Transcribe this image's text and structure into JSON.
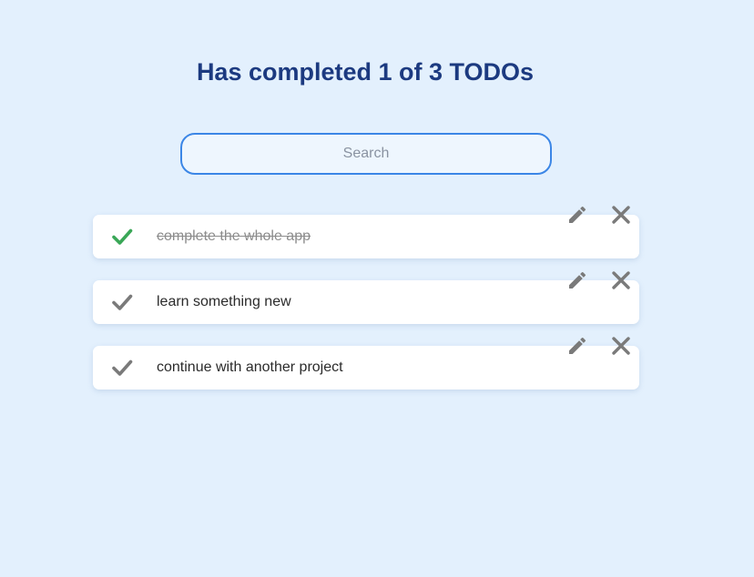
{
  "header": {
    "title": "Has completed 1 of 3 TODOs"
  },
  "search": {
    "placeholder": "Search",
    "value": ""
  },
  "todos": [
    {
      "text": "complete the whole app",
      "completed": true,
      "check_icon": "check-icon",
      "edit_icon": "pencil-icon",
      "delete_icon": "close-icon"
    },
    {
      "text": "learn something new",
      "completed": false,
      "check_icon": "check-icon",
      "edit_icon": "pencil-icon",
      "delete_icon": "close-icon"
    },
    {
      "text": "continue with another project",
      "completed": false,
      "check_icon": "check-icon",
      "edit_icon": "pencil-icon",
      "delete_icon": "close-icon"
    }
  ],
  "colors": {
    "background": "#e3f0fd",
    "title": "#1c3a80",
    "search_border": "#3b86e6",
    "check_done": "#3aa757",
    "check_pending": "#7a7a7a",
    "icon": "#7a7a7a"
  }
}
